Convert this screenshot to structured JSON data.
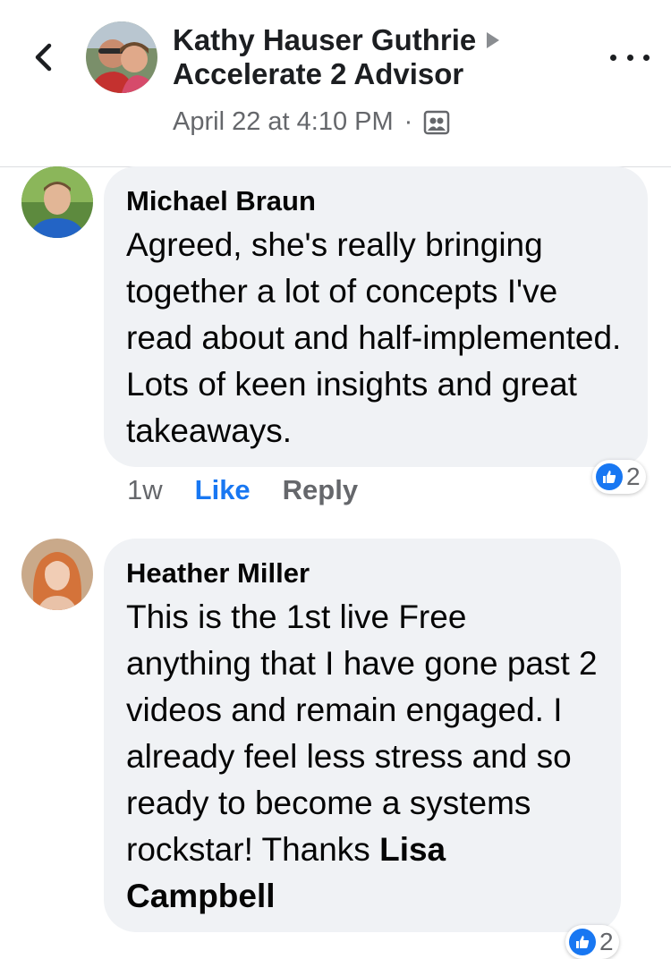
{
  "header": {
    "author": "Kathy Hauser Guthrie",
    "group": "Accelerate 2 Advisor",
    "timestamp": "April 22 at 4:10 PM",
    "separator": "·"
  },
  "comments": [
    {
      "name": "Michael Braun",
      "text": "Agreed, she's really bringing together a lot of concepts I've read about and half-implemented. Lots of keen insights and great takeaways.",
      "time": "1w",
      "like_label": "Like",
      "reply_label": "Reply",
      "reaction_count": "2"
    },
    {
      "name": "Heather Miller",
      "text": "This is the 1st live Free anything that I have gone past 2 videos and remain engaged. I already feel less stress and so ready to become a systems rockstar! Thanks ",
      "mention": "Lisa Campbell",
      "reaction_count": "2"
    }
  ],
  "colors": {
    "accent": "#1877f2",
    "bubble": "#f0f2f5",
    "secondary_text": "#65676b"
  }
}
